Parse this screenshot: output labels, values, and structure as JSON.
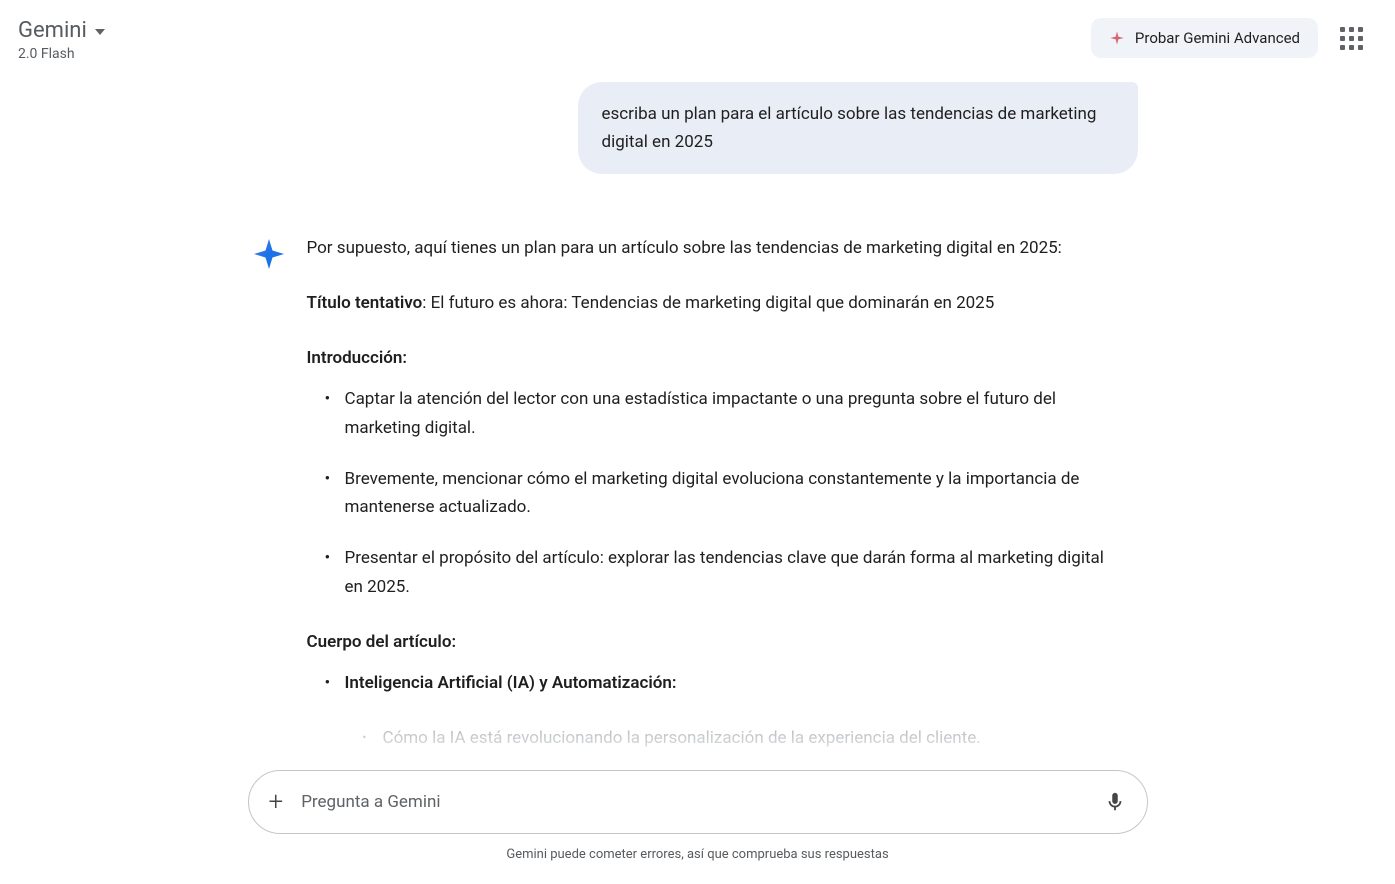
{
  "header": {
    "app_title": "Gemini",
    "app_subtitle": "2.0 Flash",
    "advanced_label": "Probar Gemini Advanced"
  },
  "chat": {
    "user_msg": "escriba un plan para el artículo sobre las tendencias de marketing digital en 2025",
    "assistant_intro": "Por supuesto, aquí tienes un plan para un artículo sobre las tendencias de marketing digital en 2025:",
    "title_label": "Título tentativo",
    "title_value": ": El futuro es ahora: Tendencias de marketing digital que dominarán en 2025",
    "intro_label": "Introducción:",
    "intro_items": [
      "Captar la atención del lector con una estadística impactante o una pregunta sobre el futuro del marketing digital.",
      "Brevemente, mencionar cómo el marketing digital evoluciona constantemente y la importancia de mantenerse actualizado.",
      "Presentar el propósito del artículo: explorar las tendencias clave que darán forma al marketing digital en 2025."
    ],
    "body_label": "Cuerpo del artículo:",
    "body_item1_bold": "Inteligencia Artificial (IA) y Automatización:",
    "body_sub1": "Cómo la IA está revolucionando la personalización de la experiencia del cliente."
  },
  "input": {
    "placeholder": "Pregunta a Gemini"
  },
  "footer": {
    "note": "Gemini puede cometer errores, así que comprueba sus respuestas"
  }
}
